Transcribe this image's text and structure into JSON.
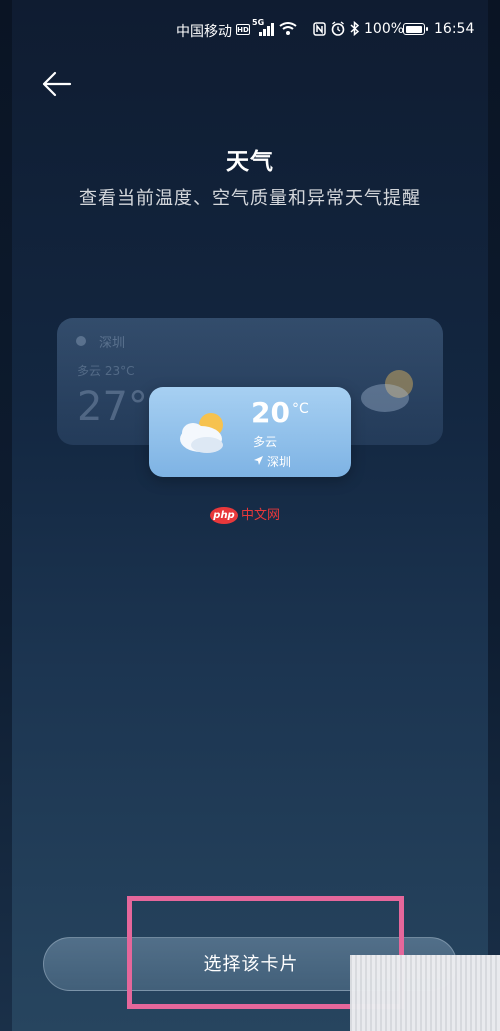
{
  "status_bar": {
    "carrier": "中国移动",
    "hd_badge": "HD",
    "network_type": "5G",
    "signal_level": 4,
    "battery_percent": "100%",
    "battery_level": 1.0,
    "time": "16:54",
    "icons": [
      "hd-icon",
      "signal-icon",
      "wifi-icon",
      "nfc-icon",
      "alarm-icon",
      "bluetooth-icon",
      "battery-icon"
    ]
  },
  "header": {
    "back_icon": "arrow-left-icon",
    "title": "天气",
    "subtitle": "查看当前温度、空气质量和异常天气提醒"
  },
  "preview": {
    "back_card": {
      "location_label": "深圳",
      "sub_label": "多云 23°C",
      "temperature": "27°"
    },
    "front_card": {
      "icon": "partly-cloudy-icon",
      "temperature": "20",
      "unit": "°C",
      "condition": "多云",
      "location_icon": "location-arrow-icon",
      "location": "深圳"
    }
  },
  "watermark": {
    "badge": "php",
    "text": "中文网"
  },
  "actions": {
    "select_label": "选择该卡片"
  },
  "colors": {
    "background_top": "#0f1c31",
    "background_bottom": "#27455f",
    "card_blue": "#8fc0ea",
    "highlight": "#e5679b",
    "watermark": "#e8383b"
  }
}
